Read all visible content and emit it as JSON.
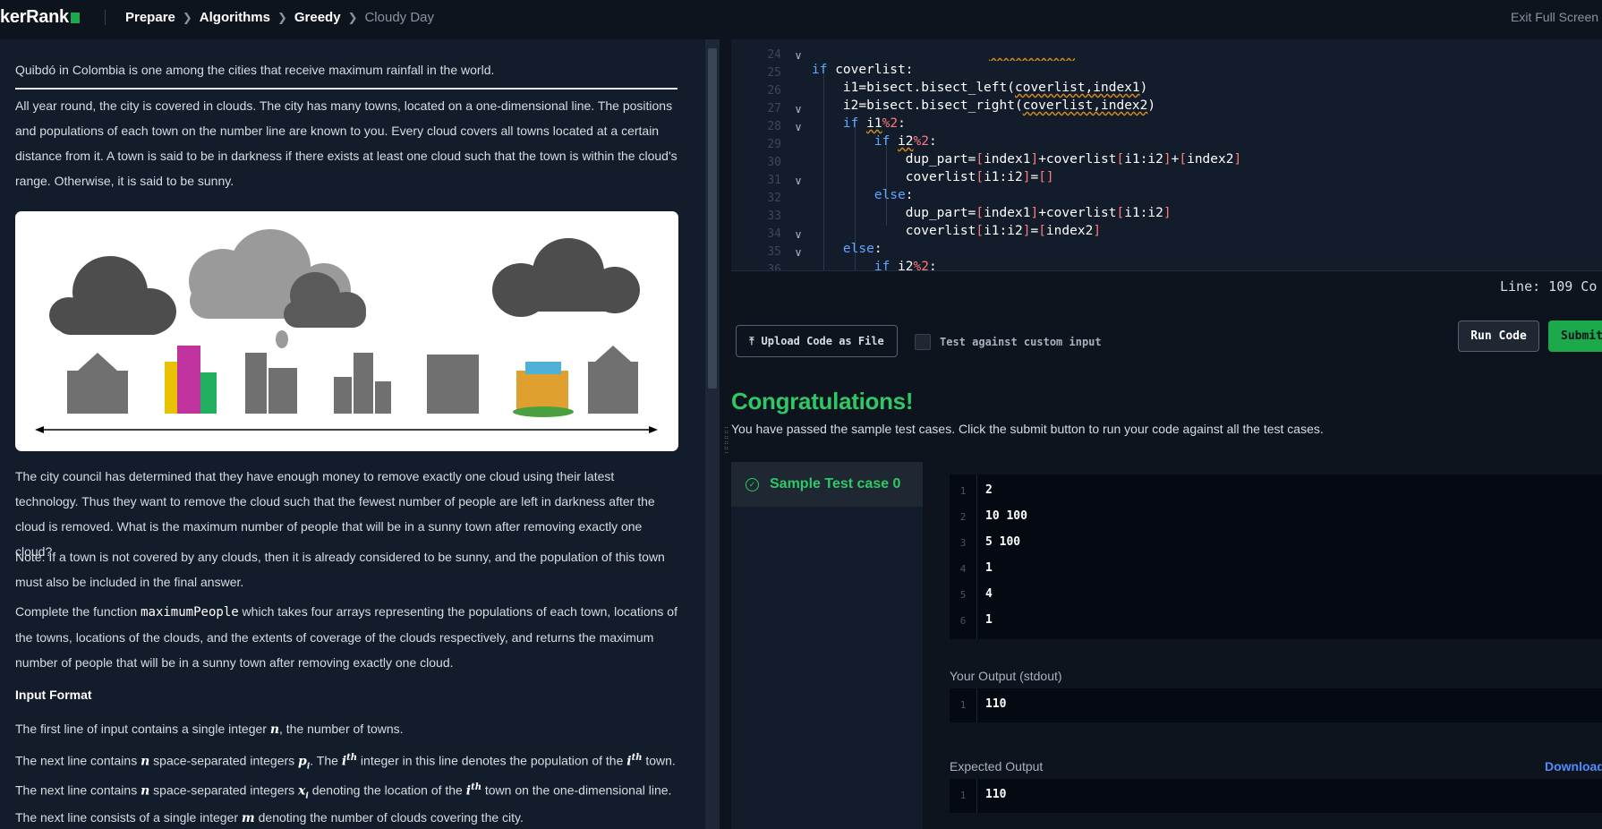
{
  "header": {
    "logo": "kerRank",
    "breadcrumbs": [
      "Prepare",
      "Algorithms",
      "Greedy",
      "Cloudy Day"
    ],
    "exit_fullscreen": "Exit Full Screen V"
  },
  "problem": {
    "intro": "Quibdó in Colombia is one among the cities that receive maximum rainfall in the world.",
    "p1": "All year round, the city is covered in clouds. The city has many towns, located on a one-dimensional line. The positions and populations of each town on the number line are known to you. Every cloud covers all towns located at a certain distance from it. A town is said to be in darkness if there exists at least one cloud such that the town is within the cloud's range. Otherwise, it is said to be sunny.",
    "p2": "The city council has determined that they have enough money to remove exactly one cloud using their latest technology. Thus they want to remove the cloud such that the fewest number of people are left in darkness after the cloud is removed. What is the maximum number of people that will be in a sunny town after removing exactly one cloud?",
    "p3": "Note: If a town is not covered by any clouds, then it is already considered to be sunny, and the population of this town must also be included in the final answer.",
    "p4_before": "Complete the function ",
    "p4_func": "maximumPeople",
    "p4_after": " which takes four arrays representing the populations of each town, locations of the towns, locations of the clouds, and the extents of coverage of the clouds respectively, and returns the maximum number of people that will be in a sunny town after removing exactly one cloud.",
    "input_format_heading": "Input Format",
    "if1_a": "The first line of input contains a single integer ",
    "if1_var": "n",
    "if1_b": ", the number of towns.",
    "if2_a": "The next line contains ",
    "if2_var": "n",
    "if2_b": " space-separated integers ",
    "if2_var2": "p",
    "if2_sub": "i",
    "if2_c": ". The ",
    "if2_i": "i",
    "if2_th": "th",
    "if2_d": " integer in this line denotes the population of the ",
    "if2_i2": "i",
    "if2_th2": "th",
    "if2_e": " town.",
    "if3_a": "The next line contains ",
    "if3_var": "n",
    "if3_b": " space-separated integers ",
    "if3_var2": "x",
    "if3_sub": "i",
    "if3_c": " denoting the location of the ",
    "if3_i": "i",
    "if3_th": "th",
    "if3_d": " town on the one-dimensional line.",
    "if4_a": "The next line consists of a single integer ",
    "if4_var": "m",
    "if4_b": " denoting the number of clouds covering the city."
  },
  "editor": {
    "line_numbers": [
      "",
      "24",
      "25",
      "26",
      "27",
      "28",
      "29",
      "30",
      "31",
      "32",
      "33",
      "34",
      "35",
      "36"
    ],
    "status": "Line: 109 Co"
  },
  "actions": {
    "upload_label": "Upload Code as File",
    "custom_input_label": "Test against custom input",
    "run_label": "Run Code",
    "submit_label": "Submit"
  },
  "result": {
    "title": "Congratulations!",
    "subtitle": "You have passed the sample test cases. Click the submit button to run your code against all the test cases.",
    "testcase_label": "Sample Test case 0",
    "input_lines": [
      "2",
      "10 100",
      "5 100",
      "1",
      "4",
      "1"
    ],
    "your_output_label": "Your Output (stdout)",
    "your_output": "110",
    "expected_output_label": "Expected Output",
    "expected_output": "110",
    "download_label": "Download"
  }
}
